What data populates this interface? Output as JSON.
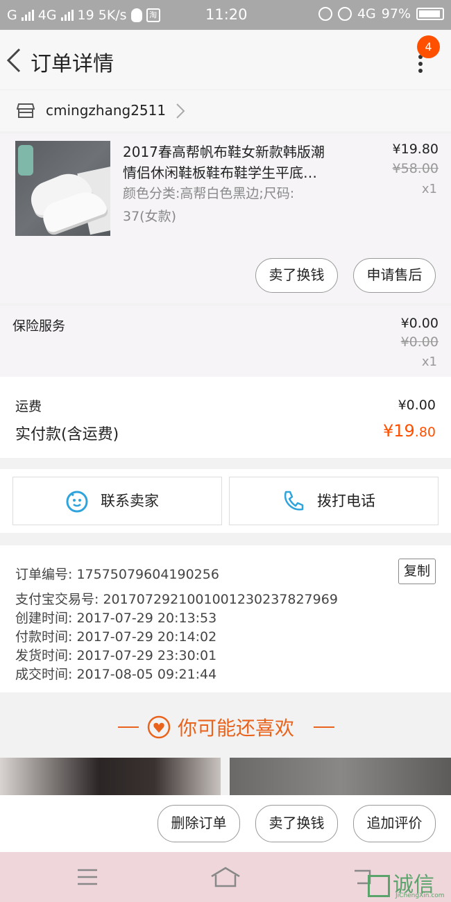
{
  "status_bar": {
    "left_text": "G",
    "network_1": "4G",
    "notif_count": "19",
    "speed": "5K/s",
    "time": "11:20",
    "network_2": "4G",
    "battery": "97%"
  },
  "header": {
    "title": "订单详情",
    "badge": "4"
  },
  "seller": {
    "name": "cmingzhang2511"
  },
  "product": {
    "title_line1": "2017春高帮帆布鞋女新款韩版潮",
    "title_line2": "情侣休闲鞋板鞋布鞋学生平底…",
    "sku_line1": "颜色分类:高帮白色黑边;尺码:",
    "sku_line2": "37(女款)",
    "price": "¥19.80",
    "original_price": "¥58.00",
    "quantity": "x1",
    "btn_resell": "卖了换钱",
    "btn_after_sale": "申请售后"
  },
  "insurance": {
    "label": "保险服务",
    "price": "¥0.00",
    "original_price": "¥0.00",
    "quantity": "x1"
  },
  "totals": {
    "freight_label": "运费",
    "freight_value": "¥0.00",
    "paid_label": "实付款(含运费)",
    "paid_currency": "¥",
    "paid_int": "19",
    "paid_dec": ".80"
  },
  "contact": {
    "seller_btn": "联系卖家",
    "call_btn": "拨打电话"
  },
  "order_info": {
    "order_no": "订单编号: 1757507960419025​6",
    "alipay_no": "支付宝交易号: 2017072921001001230237827969",
    "created": "创建时间: 2017-07-29  20:13:53",
    "paid": "付款时间: 2017-07-29  20:14:02",
    "shipped": "发货时间: 2017-07-29  23:30:01",
    "completed": "成交时间: 2017-08-05  09:21:44",
    "copy_btn": "复制"
  },
  "recommend": {
    "title": "你可能还喜欢"
  },
  "actions": {
    "delete": "删除订单",
    "resell": "卖了换钱",
    "review": "追加评价"
  },
  "watermark": {
    "brand": "诚信",
    "url": "JiChengXin.com"
  },
  "colors": {
    "accent": "#ff5000",
    "rec_orange": "#e9631c",
    "contact_blue": "#2fa3dc"
  }
}
